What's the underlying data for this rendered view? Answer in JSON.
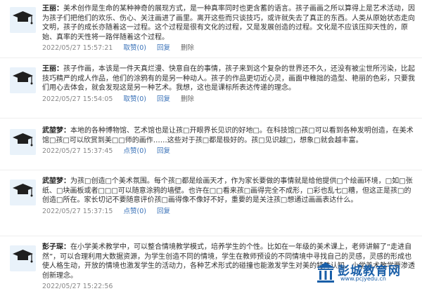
{
  "comments": [
    {
      "author": "王丽：",
      "text": "美术创作是生命的某种神奇的展现方式，是一种真率同时也更含蓄的语言。孩子画画之所以算得上是艺术活动，因为孩子们把他们的欢乐、伤心、关注画进了画里。离开这些而只谈技巧，或许就失去了真正的东西。人类从原始状态走向文明，孩子的成长亦随着这一过程。这个过程是很有文化的过程，又是发展创造的过程。文化是不应该压抑天性的，原始、真率的天性将一路伴随着这个过程。",
      "time": "2022/05/27 15:57:21",
      "likes": "取赞(0)",
      "reply": "回复",
      "delete": "删除"
    },
    {
      "author": "王丽：",
      "text": "孩子作画，本该是一件天真烂漫、快意自在的事情，孩子来到这个复杂的世界还不久，还没有被尘世所污染，比起技巧精严的成人作品，他们的涂鸦有的是另一种动人。孩子的作品更切近心灵，画面中稚拙的造型、艳丽的色彩，只要我们用心去体会，就会发现这是另一种艺术。我想，这也是课标所表达传递的理念。",
      "time": "2022/05/27 15:54:05",
      "likes": "取赞(0)",
      "reply": "回复",
      "delete": "删除"
    },
    {
      "author": "武堃梦：",
      "text": "本地的各种博物馆、艺术馆也是让孩□开眼界长见识的好地□。在科技馆□孩□可以看到各种发明创造，在美术馆□孩□可以欣赏到美□□师的画作……这些对于孩□都是极好的。孩□见识越□，想象□就会越丰富。",
      "time": "2022/05/27 15:37:45",
      "likes": "点赞(0)",
      "reply": "回复",
      "delete": ""
    },
    {
      "author": "武堃梦：",
      "text": "为孩□创造□个美术氛围。每个孩□都是绘画天才，作为家长要做的事情就是给他提供□个绘画环境，□如□张纸、□块画板或者□□□可以随意涂鸦的墙壁。也许在□□看来孩□画得完全不成形，□彩也乱七□糟，但这正是孩□的创造□所在。家长切记不要随意评价孩□画得像不像好不好，重要的是关注孩□想通过画画表达什么。",
      "time": "2022/05/27 15:37:15",
      "likes": "点赞(0)",
      "reply": "回复",
      "delete": ""
    },
    {
      "author": "彭子琛：",
      "text": "在小学美术教学中，可以整合情境教学模式，培养学生的个性。比如在一年级的美术课上，老师讲解了“走进自然”，可以合理利用大数据资源，为学生创造不同的情境，学生在教师预设的不同情境中寻找自己的灵感，灵感的形成也使人格生动，开放的情境也激发学生的活动力，各种艺术形式的碰撞也能激发学生对美的特殊认知。小学美术教学要渗透创新理念。",
      "time": "2022/05/27 15:22:56",
      "likes": "",
      "reply": "",
      "delete": ""
    }
  ],
  "logo": {
    "main": "彭城教育网",
    "sub": "www.pcjyedu.cn"
  },
  "colors": {
    "link": "#3a72b8",
    "logo": "#1a5fa8",
    "avatar_bg": "#e9f2fa",
    "cap": "#1f1f1f"
  }
}
